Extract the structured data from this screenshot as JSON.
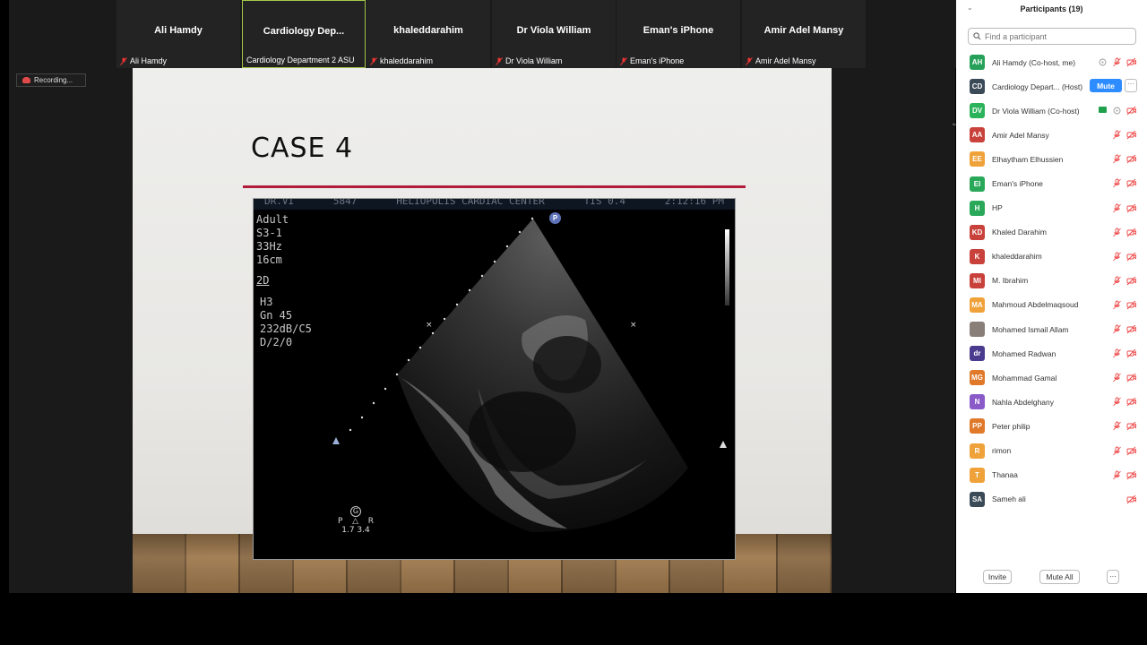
{
  "thumbnails": [
    {
      "name": "Ali Hamdy",
      "label": "Ali Hamdy"
    },
    {
      "name": "Cardiology  Dep...",
      "label": "Cardiology Department 2 ASU"
    },
    {
      "name": "khaleddarahim",
      "label": "khaleddarahim"
    },
    {
      "name": "Dr Viola William",
      "label": "Dr Viola William"
    },
    {
      "name": "Eman's iPhone",
      "label": "Eman's iPhone"
    },
    {
      "name": "Amir Adel Mansy",
      "label": "Amir Adel Mansy"
    }
  ],
  "recording": {
    "label": "Recording..."
  },
  "slide": {
    "title": "CASE 4",
    "echo": {
      "header": [
        "DR.VI",
        "5847",
        "HELIOPOLIS CARDIAC CENTER",
        "TIS 0.4",
        "2:12:16 PM"
      ],
      "params": [
        "Adult",
        "S3-1",
        "33Hz",
        "16cm"
      ],
      "mode": "2D",
      "params2": [
        "H3",
        "Gn 45",
        "232dB/C5",
        "D/2/0"
      ],
      "probe_badge": "P",
      "orient_g": "G",
      "orient_p": "P",
      "orient_r": "R",
      "orient_vals": "1.7  3.4"
    }
  },
  "panel": {
    "title": "Participants (19)",
    "search_placeholder": "Find a participant",
    "mute_label": "Mute",
    "invite_label": "Invite",
    "mute_all_label": "Mute All",
    "participants": [
      {
        "initials": "AH",
        "name": "Ali Hamdy (Co-host, me)",
        "color": "#27a15a"
      },
      {
        "initials": "CD",
        "name": "Cardiology Depart...  (Host)",
        "color": "#3b4a57"
      },
      {
        "initials": "DV",
        "name": "Dr Viola William (Co-host)",
        "color": "#2bb35b"
      },
      {
        "initials": "AA",
        "name": "Amir Adel Mansy",
        "color": "#c8413a"
      },
      {
        "initials": "EE",
        "name": "Elhaytham Elhussien",
        "color": "#f0a23a"
      },
      {
        "initials": "EI",
        "name": "Eman's iPhone",
        "color": "#2aa85a"
      },
      {
        "initials": "H",
        "name": "HP",
        "color": "#2aa85a"
      },
      {
        "initials": "KD",
        "name": "Khaled Darahim",
        "color": "#c8413a"
      },
      {
        "initials": "K",
        "name": "khaleddarahim",
        "color": "#c8413a"
      },
      {
        "initials": "MI",
        "name": "M. Ibrahim",
        "color": "#c8413a"
      },
      {
        "initials": "MA",
        "name": "Mahmoud Abdelmaqsoud",
        "color": "#f0a23a"
      },
      {
        "initials": "",
        "name": "Mohamed Ismail Allam",
        "color": "#8a7f78"
      },
      {
        "initials": "dr",
        "name": "Mohamed Radwan",
        "color": "#4b3b8e"
      },
      {
        "initials": "MG",
        "name": "Mohammad Gamal",
        "color": "#e07a2a"
      },
      {
        "initials": "N",
        "name": "Nahla Abdelghany",
        "color": "#8a5ac8"
      },
      {
        "initials": "PP",
        "name": "Peter philip",
        "color": "#e07a2a"
      },
      {
        "initials": "R",
        "name": "rimon",
        "color": "#f0a23a"
      },
      {
        "initials": "T",
        "name": "Thanaa",
        "color": "#f0a23a"
      },
      {
        "initials": "SA",
        "name": "Sameh ali",
        "color": "#3b4a57"
      }
    ]
  }
}
